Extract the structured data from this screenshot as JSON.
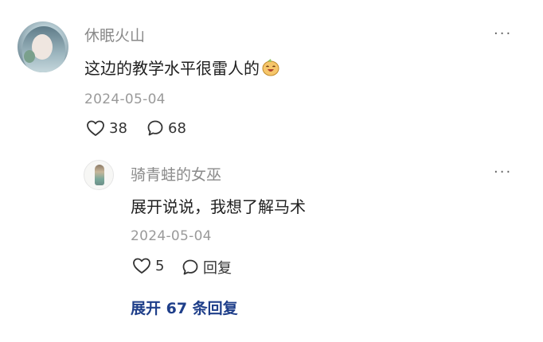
{
  "comment": {
    "username": "休眠火山",
    "text": "这边的教学水平很雷人的",
    "date": "2024-05-04",
    "likes": "38",
    "replies": "68"
  },
  "reply": {
    "username": "骑青蛙的女巫",
    "text": "展开说说，我想了解马术",
    "date": "2024-05-04",
    "likes": "5",
    "reply_label": "回复"
  },
  "more_label": "···",
  "expand_label": "展开 67 条回复",
  "icons": {
    "like": "heart-outline-icon",
    "comment": "chat-bubble-icon",
    "more": "more-dots-icon",
    "emoji": "laughing-face-emoji"
  },
  "colors": {
    "link": "#1f3f8a",
    "muted": "#9a9a9a"
  }
}
